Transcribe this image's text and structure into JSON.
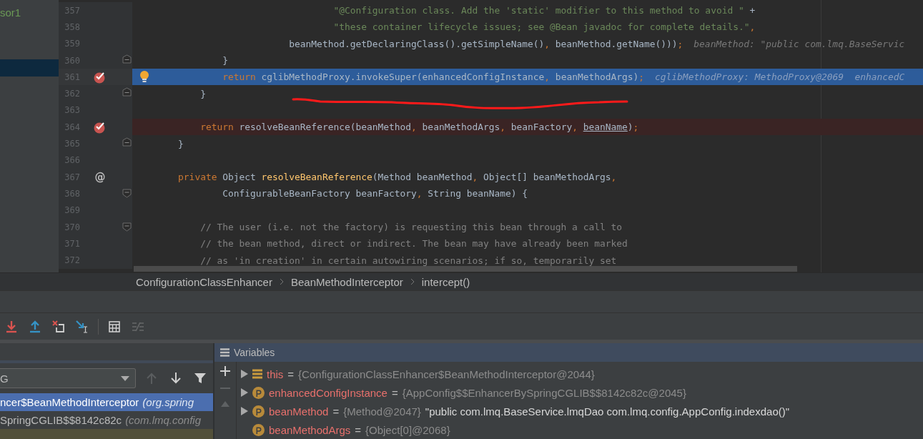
{
  "project_tree": {
    "items": [
      {
        "label": "sor1",
        "selected": false
      },
      {
        "selected": true
      }
    ]
  },
  "editor": {
    "lines": [
      {
        "number": "357",
        "kind": "plain",
        "tokens": [
          {
            "kind": "string",
            "text": "                                    \"@Configuration class. Add the 'static' modifier to this method to avoid \""
          },
          {
            "kind": "plain",
            "text": " +"
          }
        ]
      },
      {
        "number": "358",
        "kind": "plain",
        "tokens": [
          {
            "kind": "string",
            "text": "                                    \"these container lifecycle issues; see @Bean javadoc for complete details.\""
          },
          {
            "kind": "comma",
            "text": ","
          }
        ]
      },
      {
        "number": "359",
        "kind": "plain",
        "tokens": [
          {
            "kind": "plain",
            "text": "                            beanMethod.getDeclaringClass().getSimpleName()"
          },
          {
            "kind": "comma",
            "text": ","
          },
          {
            "kind": "plain",
            "text": " beanMethod.getName()))"
          },
          {
            "kind": "comma",
            "text": ";"
          }
        ],
        "hint": "beanMethod: \"public com.lmq.BaseServic"
      },
      {
        "number": "360",
        "kind": "plain",
        "fold": {
          "kind": "end"
        },
        "tokens": [
          {
            "kind": "plain",
            "text": "                }"
          }
        ]
      },
      {
        "number": "361",
        "kind": "execution",
        "bulb": true,
        "marker": {
          "kind": "breakpoint"
        },
        "tokens": [
          {
            "kind": "keyword",
            "text": "                return"
          },
          {
            "kind": "plain",
            "text": " cglibMethodProxy.invokeSuper(enhancedConfigInstance"
          },
          {
            "kind": "comma",
            "text": ","
          },
          {
            "kind": "plain",
            "text": " beanMethodArgs)"
          },
          {
            "kind": "comma",
            "text": ";"
          }
        ],
        "hint": "cglibMethodProxy: MethodProxy@2069  enhancedC"
      },
      {
        "number": "362",
        "kind": "plain",
        "fold": {
          "kind": "end"
        },
        "tokens": [
          {
            "kind": "plain",
            "text": "            }"
          }
        ]
      },
      {
        "number": "363",
        "kind": "plain"
      },
      {
        "number": "364",
        "kind": "breakpoint",
        "marker": {
          "kind": "breakpoint"
        },
        "tokens": [
          {
            "kind": "keyword",
            "text": "            return"
          },
          {
            "kind": "plain",
            "text": " resolveBeanReference(beanMethod"
          },
          {
            "kind": "comma",
            "text": ","
          },
          {
            "kind": "plain",
            "text": " beanMethodArgs"
          },
          {
            "kind": "comma",
            "text": ","
          },
          {
            "kind": "plain",
            "text": " beanFactory"
          },
          {
            "kind": "comma",
            "text": ","
          },
          {
            "kind": "underlined",
            "text": " beanName"
          },
          {
            "kind": "plain",
            "text": ")"
          },
          {
            "kind": "comma",
            "text": ";"
          }
        ]
      },
      {
        "number": "365",
        "kind": "plain",
        "fold": {
          "kind": "end"
        },
        "tokens": [
          {
            "kind": "plain",
            "text": "        }"
          }
        ]
      },
      {
        "number": "366",
        "kind": "plain"
      },
      {
        "number": "367",
        "kind": "plain",
        "marker": {
          "kind": "text",
          "text": "@"
        },
        "tokens": [
          {
            "kind": "keyword",
            "text": "        private"
          },
          {
            "kind": "plain",
            "text": " Object "
          },
          {
            "kind": "declaration",
            "text": "resolveBeanReference"
          },
          {
            "kind": "plain",
            "text": "(Method beanMethod"
          },
          {
            "kind": "comma",
            "text": ","
          },
          {
            "kind": "plain",
            "text": " Object[] beanMethodArgs"
          },
          {
            "kind": "comma",
            "text": ","
          }
        ]
      },
      {
        "number": "368",
        "kind": "plain",
        "fold": {
          "kind": "start"
        },
        "tokens": [
          {
            "kind": "plain",
            "text": "                ConfigurableBeanFactory beanFactory"
          },
          {
            "kind": "comma",
            "text": ","
          },
          {
            "kind": "plain",
            "text": " String beanName) {"
          }
        ]
      },
      {
        "number": "369",
        "kind": "plain"
      },
      {
        "number": "370",
        "kind": "plain",
        "fold": {
          "kind": "start"
        },
        "tokens": [
          {
            "kind": "comment",
            "text": "            // The user (i.e. not the factory) is requesting this bean through a call to"
          }
        ]
      },
      {
        "number": "371",
        "kind": "plain",
        "tokens": [
          {
            "kind": "comment",
            "text": "            // the bean method, direct or indirect. The bean may have already been marked"
          }
        ]
      },
      {
        "number": "372",
        "kind": "plain",
        "tokens": [
          {
            "kind": "comment",
            "text": "            // as 'in creation' in certain autowiring scenarios; if so, temporarily set"
          }
        ]
      }
    ]
  },
  "breadcrumbs": [
    "ConfigurationClassEnhancer",
    "BeanMethodInterceptor",
    "intercept()"
  ],
  "debug_toolbar": [
    {
      "kind": "step-into",
      "disabled": false
    },
    {
      "kind": "step-out",
      "disabled": false
    },
    {
      "kind": "drop-frame",
      "disabled": false
    },
    {
      "kind": "run-to-cursor",
      "disabled": false
    },
    {
      "kind": "separator"
    },
    {
      "kind": "evaluate",
      "disabled": false
    },
    {
      "kind": "trace",
      "disabled": true
    }
  ],
  "frames": {
    "thread": "G",
    "items": [
      {
        "name": "ncer$BeanMethodInterceptor",
        "location": "(org.spring",
        "selected": true
      },
      {
        "name": "SpringCGLIB$$8142c82c",
        "location": "(com.lmq.config",
        "selected": false
      }
    ]
  },
  "variables": {
    "title": "Variables",
    "rows": [
      {
        "kind": "object",
        "expandable": true,
        "name": "this",
        "operator": "=",
        "value": "{ConfigurationClassEnhancer$BeanMethodInterceptor@2044}"
      },
      {
        "kind": "parameter",
        "expandable": true,
        "name": "enhancedConfigInstance",
        "operator": "=",
        "value": "{AppConfig$$EnhancerBySpringCGLIB$$8142c82c@2045}"
      },
      {
        "kind": "parameter",
        "expandable": true,
        "name": "beanMethod",
        "operator": "=",
        "value": "{Method@2047}",
        "text": "\"public com.lmq.BaseService.lmqDao com.lmq.config.AppConfig.indexdao()\""
      },
      {
        "kind": "parameter",
        "expandable": false,
        "name": "beanMethodArgs",
        "operator": "=",
        "value": "{Object[0]@2068}"
      }
    ]
  }
}
